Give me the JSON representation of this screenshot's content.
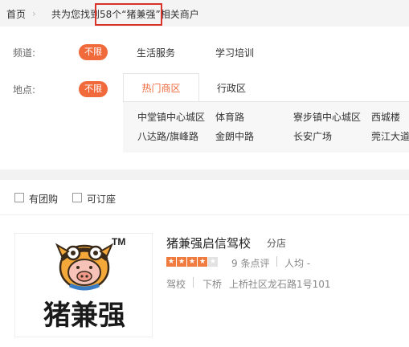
{
  "breadcrumb": {
    "home": "首页",
    "text": "共为您找到58个“猪兼强”相关商户"
  },
  "filter": {
    "channel_label": "频道:",
    "location_label": "地点:",
    "unlimited": "不限",
    "channels": [
      "生活服务",
      "学习培训"
    ],
    "tabs": {
      "active": "热门商区",
      "other": "行政区"
    },
    "areas": [
      "中堂镇中心城区",
      "体育路",
      "寮步镇中心城区",
      "西城楼",
      "八达路/旗峰路",
      "金朗中路",
      "长安广场",
      "莞江大道"
    ]
  },
  "options": {
    "group_buy": "有团购",
    "bookable": "可订座"
  },
  "merchant": {
    "name": "猪兼强启信驾校",
    "branch": "分店",
    "reviews": "9 条点评",
    "avg_price": "人均 -",
    "category": "驾校",
    "district": "下桥",
    "address": "上桥社区龙石路1号101",
    "rating_stars": 4,
    "logo_text": "猪兼强",
    "logo_tm": "TM"
  },
  "colors": {
    "accent": "#f06a3c",
    "highlight_box": "#d8322a"
  }
}
